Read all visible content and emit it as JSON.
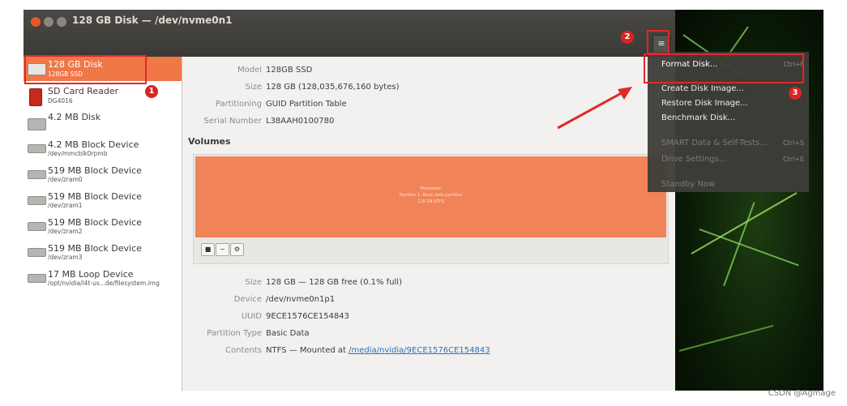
{
  "window": {
    "title": "128 GB Disk — /dev/nvme0n1",
    "menu_icon": "hamburger-icon",
    "menu_glyph": "≡"
  },
  "sidebar": {
    "items": [
      {
        "name": "128 GB Disk",
        "sub": "128GB SSD",
        "icon": "disk-icon"
      },
      {
        "name": "SD Card Reader",
        "sub": "DG4016",
        "icon": "sd-card-icon"
      },
      {
        "name": "4.2 MB Disk",
        "sub": "",
        "icon": "disk-icon"
      },
      {
        "name": "4.2 MB Block Device",
        "sub": "/dev/mmcblk0rpmb",
        "icon": "block-device-icon"
      },
      {
        "name": "519 MB Block Device",
        "sub": "/dev/zram0",
        "icon": "block-device-icon"
      },
      {
        "name": "519 MB Block Device",
        "sub": "/dev/zram1",
        "icon": "block-device-icon"
      },
      {
        "name": "519 MB Block Device",
        "sub": "/dev/zram2",
        "icon": "block-device-icon"
      },
      {
        "name": "519 MB Block Device",
        "sub": "/dev/zram3",
        "icon": "block-device-icon"
      },
      {
        "name": "17 MB Loop Device",
        "sub": "/opt/nvidia/l4t-us...de/filesystem.img",
        "icon": "loop-device-icon"
      }
    ]
  },
  "disk_info": {
    "model_label": "Model",
    "model": "128GB SSD",
    "size_label": "Size",
    "size": "128 GB (128,035,676,160 bytes)",
    "partitioning_label": "Partitioning",
    "partitioning": "GUID Partition Table",
    "serial_label": "Serial Number",
    "serial": "L38AAH0100780"
  },
  "volumes": {
    "heading": "Volumes",
    "partition_text": [
      "Filesystem",
      "Partition 1: Basic data partition",
      "128 GB NTFS"
    ],
    "toolbar": {
      "stop": "■",
      "minus": "−",
      "settings": "⚙"
    }
  },
  "partition_info": {
    "size_label": "Size",
    "size": "128 GB — 128 GB free (0.1% full)",
    "device_label": "Device",
    "device": "/dev/nvme0n1p1",
    "uuid_label": "UUID",
    "uuid": "9ECE1576CE154843",
    "ptype_label": "Partition Type",
    "ptype": "Basic Data",
    "contents_label": "Contents",
    "contents_prefix": "NTFS — Mounted at ",
    "mount_link": "/media/nvidia/9ECE1576CE154843"
  },
  "menu": {
    "items": [
      {
        "label": "Format Disk...",
        "shortcut": "Ctrl+F",
        "state": "highlighted"
      },
      {
        "label": "Create Disk Image...",
        "shortcut": "",
        "state": "enabled"
      },
      {
        "label": "Restore Disk Image...",
        "shortcut": "",
        "state": "enabled"
      },
      {
        "label": "Benchmark Disk...",
        "shortcut": "",
        "state": "enabled"
      },
      {
        "label": "SMART Data & Self-Tests...",
        "shortcut": "Ctrl+S",
        "state": "disabled"
      },
      {
        "label": "Drive Settings...",
        "shortcut": "Ctrl+E",
        "state": "disabled"
      },
      {
        "label": "Standby Now",
        "shortcut": "",
        "state": "disabled"
      }
    ]
  },
  "annotations": {
    "badge1": "1",
    "badge2": "2",
    "badge3": "3",
    "color": "#e0282a"
  },
  "credit": "CSDN @Agmage",
  "colors": {
    "selection": "#f07746",
    "partition": "#f08458",
    "titlebar": "#3b3a36",
    "menu_bg": "#3e3d39"
  }
}
